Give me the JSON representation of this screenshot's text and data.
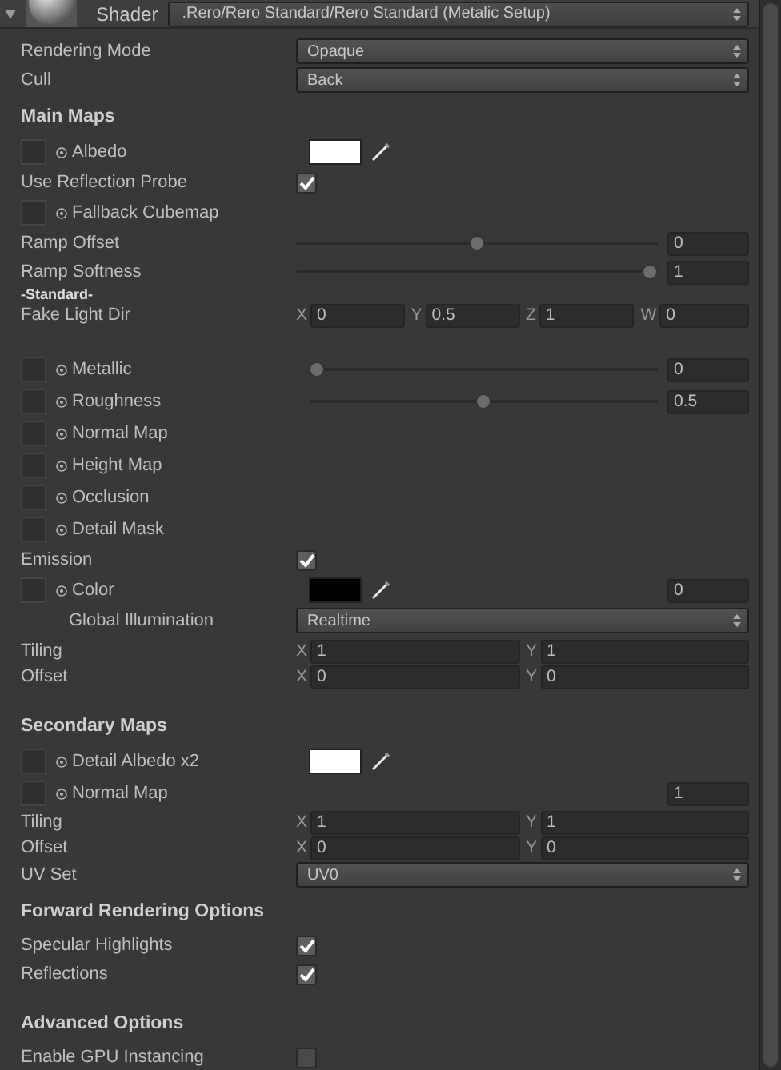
{
  "header": {
    "label": "Shader",
    "shader": ".Rero/Rero Standard/Rero Standard (Metalic Setup)"
  },
  "rows": [
    {
      "kind": "dropdown",
      "label": "Rendering Mode",
      "value": "Opaque"
    },
    {
      "kind": "dropdown",
      "label": "Cull",
      "value": "Back"
    },
    {
      "kind": "header",
      "label": "Main Maps"
    },
    {
      "kind": "texture",
      "label": "Albedo",
      "color": "#ffffff"
    },
    {
      "kind": "toggle",
      "label": "Use Reflection Probe",
      "checked": true
    },
    {
      "kind": "texture",
      "label": "Fallback Cubemap"
    },
    {
      "kind": "slider",
      "label": "Ramp Offset",
      "level": 0.5,
      "value": "0"
    },
    {
      "kind": "slider",
      "label": "Ramp Softness",
      "level": 1,
      "value": "1"
    },
    {
      "kind": "note",
      "label": "-Standard-"
    },
    {
      "kind": "vector",
      "label": "Fake Light Dir",
      "components": [
        {
          "axis": "X",
          "value": "0"
        },
        {
          "axis": "Y",
          "value": "0.5"
        },
        {
          "axis": "Z",
          "value": "1"
        },
        {
          "axis": "W",
          "value": "0"
        }
      ]
    },
    {
      "kind": "texture",
      "label": "Metallic",
      "level": 0,
      "value": "0"
    },
    {
      "kind": "texture",
      "label": "Roughness",
      "level": 0.5,
      "value": "0.5"
    },
    {
      "kind": "texture",
      "label": "Normal Map"
    },
    {
      "kind": "texture",
      "label": "Height Map"
    },
    {
      "kind": "texture",
      "label": "Occlusion"
    },
    {
      "kind": "texture",
      "label": "Detail Mask"
    },
    {
      "kind": "toggle",
      "label": "Emission",
      "checked": true
    },
    {
      "kind": "texture",
      "label": "Color",
      "color": "#000000",
      "value": "0"
    },
    {
      "kind": "dropdown",
      "label": "Global Illumination",
      "value": "Realtime",
      "indented": true
    },
    {
      "kind": "vector",
      "label": "Tiling",
      "components": [
        {
          "axis": "X",
          "value": "1"
        },
        {
          "axis": "Y",
          "value": "1"
        }
      ]
    },
    {
      "kind": "vector",
      "label": "Offset",
      "components": [
        {
          "axis": "X",
          "value": "0"
        },
        {
          "axis": "Y",
          "value": "0"
        }
      ]
    },
    {
      "kind": "header",
      "label": "Secondary Maps"
    },
    {
      "kind": "texture",
      "label": "Detail Albedo x2",
      "color": "#ffffff"
    },
    {
      "kind": "texture",
      "label": "Normal Map",
      "value": "1"
    },
    {
      "kind": "vector",
      "label": "Tiling",
      "components": [
        {
          "axis": "X",
          "value": "1"
        },
        {
          "axis": "Y",
          "value": "1"
        }
      ]
    },
    {
      "kind": "vector",
      "label": "Offset",
      "components": [
        {
          "axis": "X",
          "value": "0"
        },
        {
          "axis": "Y",
          "value": "0"
        }
      ]
    },
    {
      "kind": "dropdown",
      "label": "UV Set",
      "value": "UV0"
    },
    {
      "kind": "header",
      "label": "Forward Rendering Options"
    },
    {
      "kind": "toggle",
      "label": "Specular Highlights",
      "checked": true
    },
    {
      "kind": "toggle",
      "label": "Reflections",
      "checked": true
    },
    {
      "kind": "header",
      "label": "Advanced Options"
    },
    {
      "kind": "toggle",
      "label": "Enable GPU Instancing",
      "checked": false
    }
  ]
}
